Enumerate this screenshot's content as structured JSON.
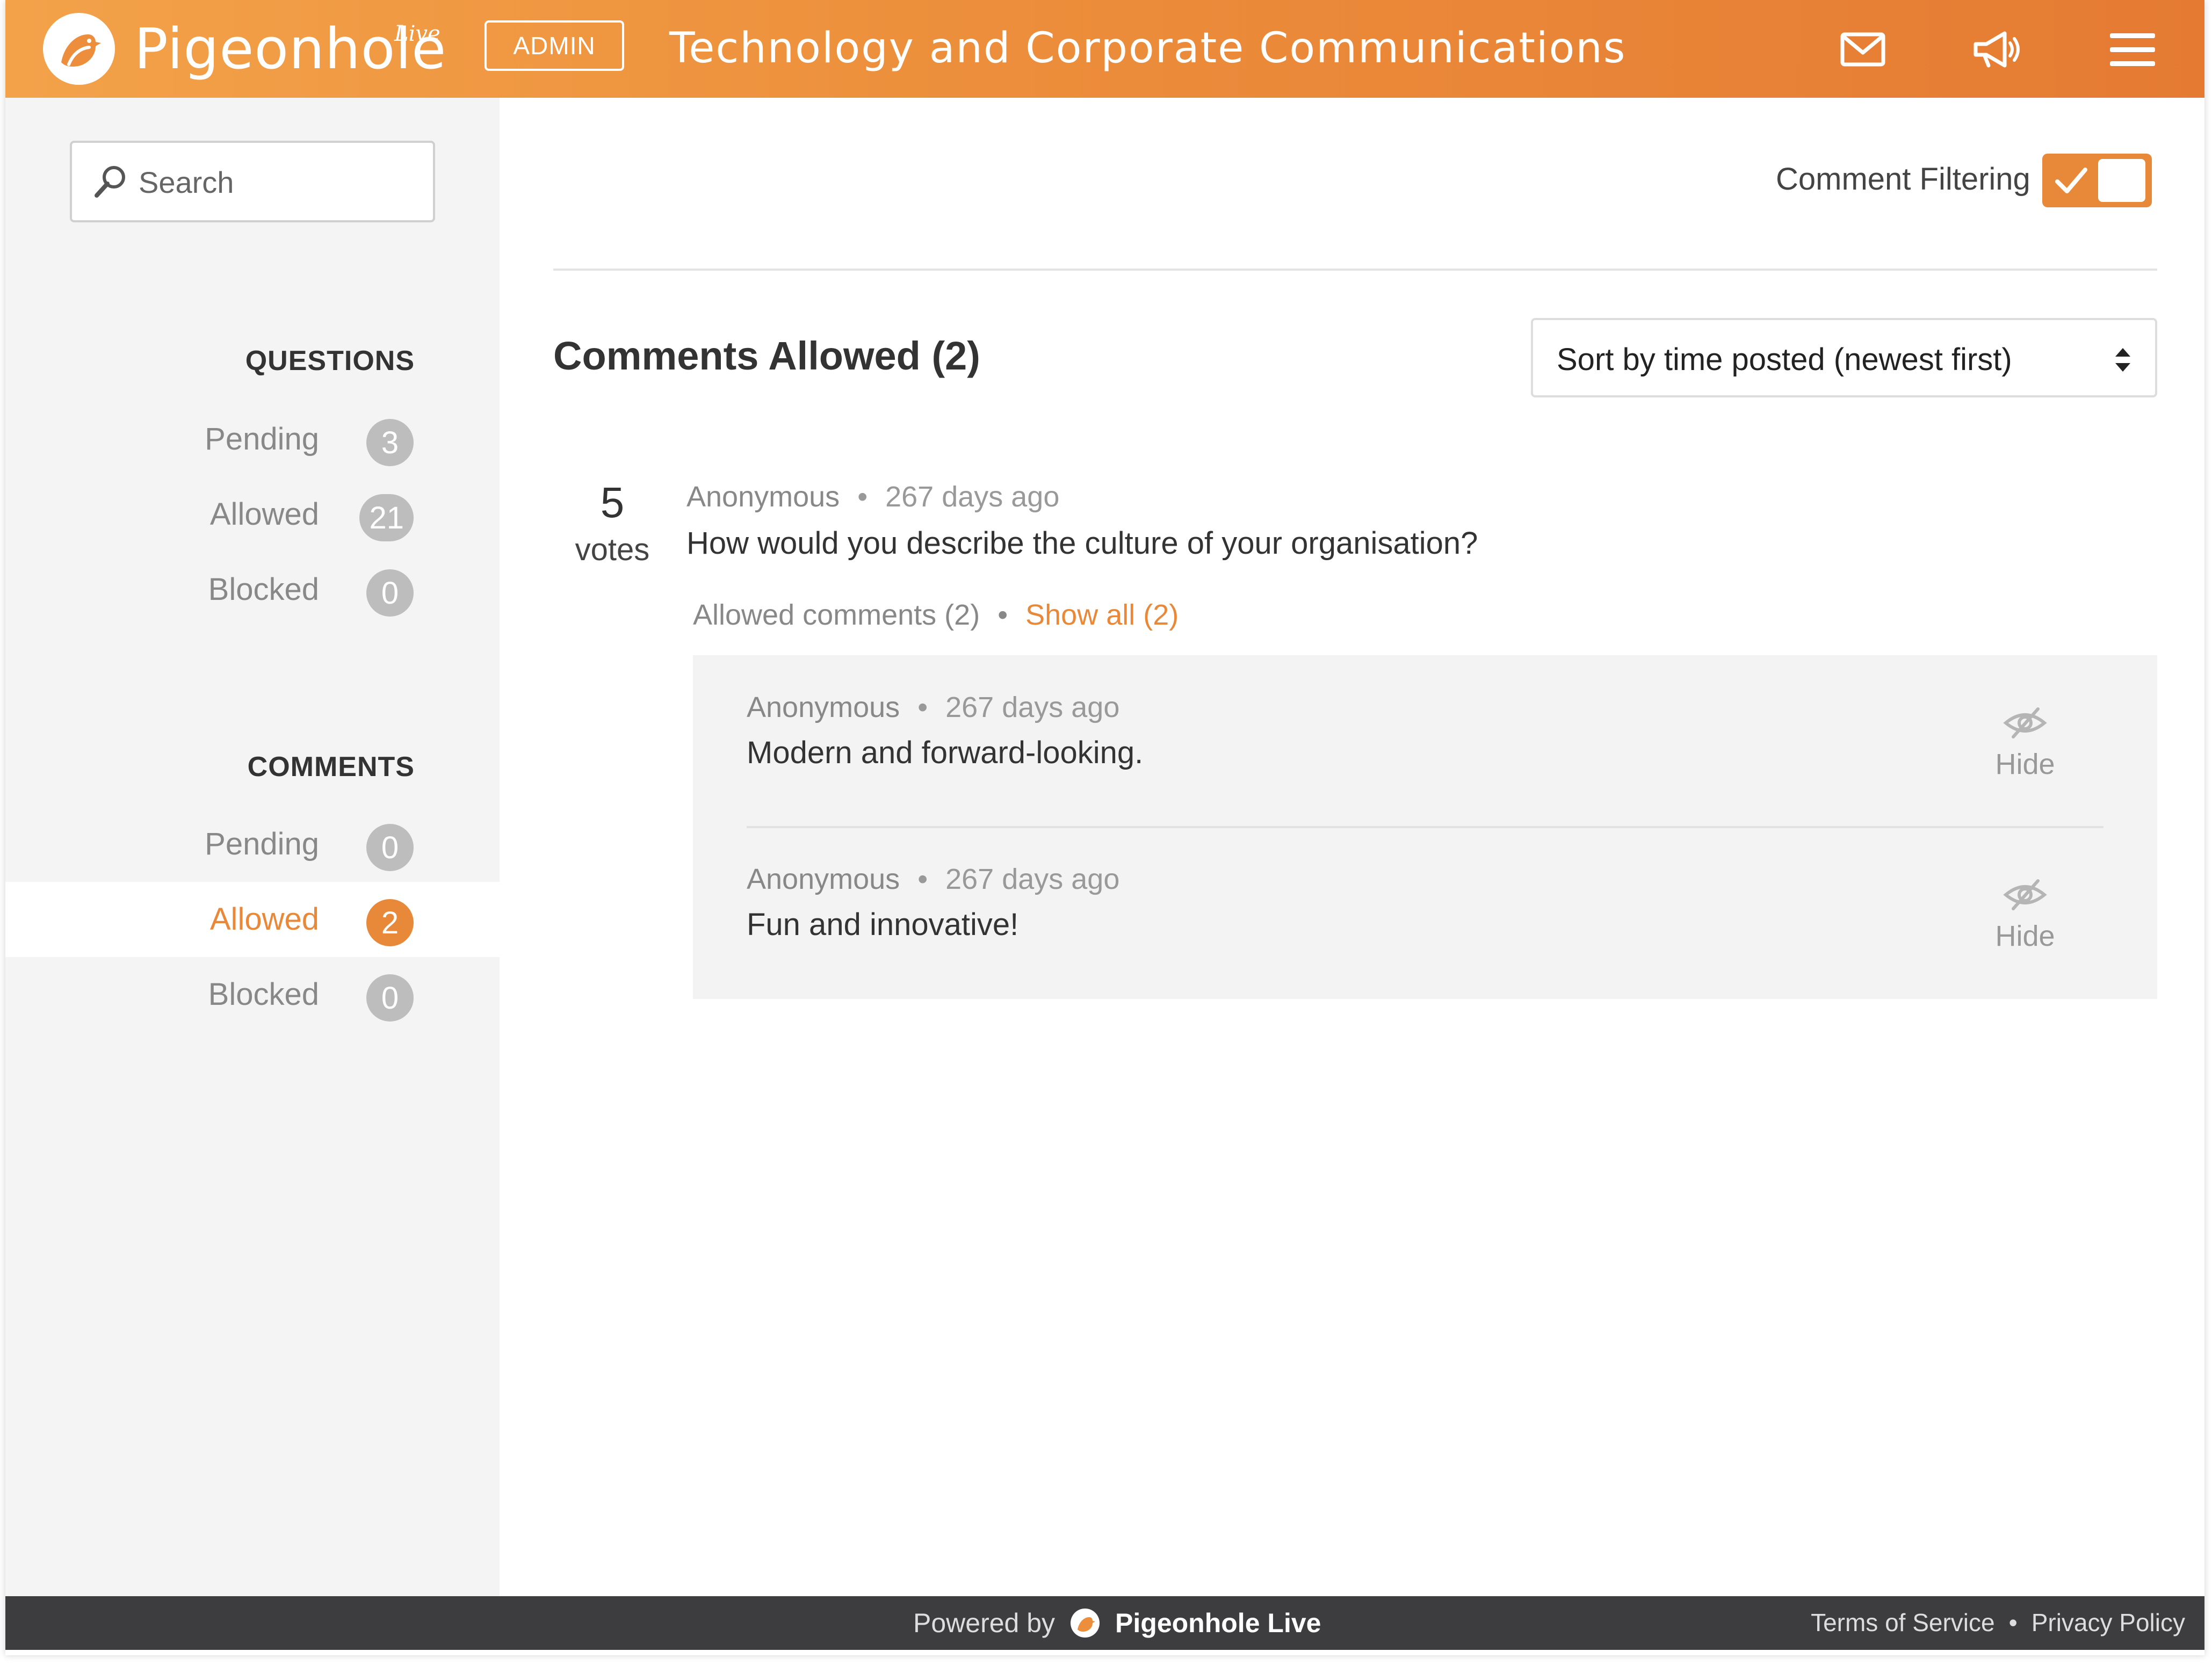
{
  "header": {
    "logo_text": "Pigeonhole",
    "logo_superscript": "Live",
    "admin_label": "ADMIN",
    "title": "Technology and Corporate Communications",
    "icons": [
      "mail-icon",
      "announcement-icon",
      "hamburger-menu-icon"
    ],
    "gradient": [
      "#f3a24a",
      "#e57b33"
    ]
  },
  "sidebar": {
    "search": {
      "placeholder": "Search",
      "value": ""
    },
    "questions": {
      "title": "QUESTIONS",
      "items": [
        {
          "label": "Pending",
          "count": "3"
        },
        {
          "label": "Allowed",
          "count": "21"
        },
        {
          "label": "Blocked",
          "count": "0"
        }
      ]
    },
    "comments": {
      "title": "COMMENTS",
      "items": [
        {
          "label": "Pending",
          "count": "0"
        },
        {
          "label": "Allowed",
          "count": "2",
          "active": true
        },
        {
          "label": "Blocked",
          "count": "0"
        }
      ]
    }
  },
  "main": {
    "filter_label": "Comment Filtering",
    "filter_enabled": true,
    "heading": "Comments Allowed (2)",
    "sort": {
      "selected": "Sort by time posted (newest first)"
    },
    "question": {
      "votes": "5",
      "votes_label": "votes",
      "author": "Anonymous",
      "time": "267 days ago",
      "text": "How would you describe the culture of your organisation?",
      "allowed_comments_label": "Allowed comments (2)",
      "show_all_label": "Show all (2)",
      "comments": [
        {
          "author": "Anonymous",
          "time": "267 days ago",
          "text": "Modern and forward-looking.",
          "action_label": "Hide"
        },
        {
          "author": "Anonymous",
          "time": "267 days ago",
          "text": "Fun and innovative!",
          "action_label": "Hide"
        }
      ]
    }
  },
  "footer": {
    "powered_by": "Powered by",
    "brand": "Pigeonhole Live",
    "terms": "Terms of Service",
    "privacy": "Privacy Policy",
    "separator": "•"
  },
  "colors": {
    "accent": "#e8893a",
    "badge_grey": "#bdbdbd",
    "sidebar_bg": "#f4f4f4",
    "footer_bg": "#3d3d40"
  }
}
